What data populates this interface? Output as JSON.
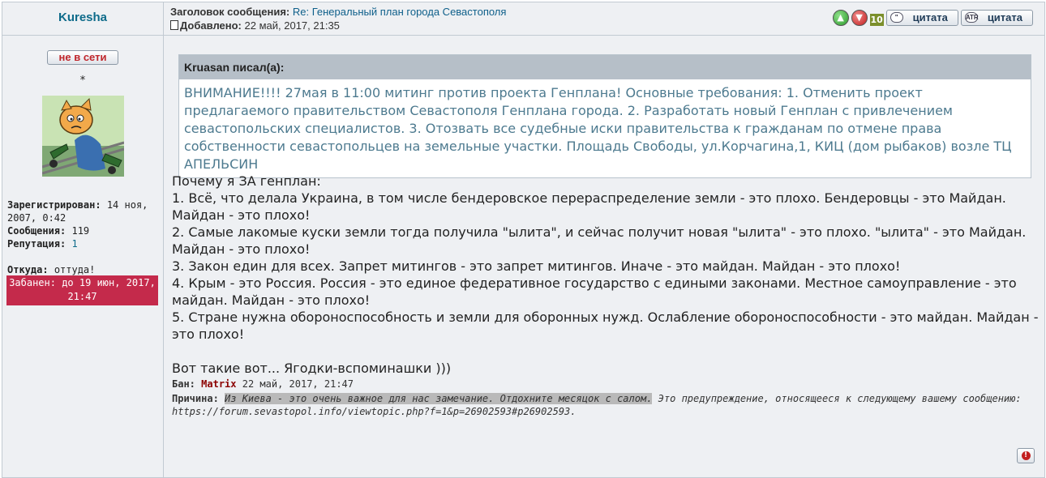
{
  "author": {
    "name": "Kuresha",
    "status_label": "не в сети",
    "rank": "*",
    "registered_label": "Зарегистрирован:",
    "registered_value": "14 ноя, 2007, 0:42",
    "posts_label": "Сообщения:",
    "posts_value": "119",
    "reputation_label": "Репутация:",
    "reputation_value": "1",
    "from_label": "Откуда:",
    "from_value": "оттуда!",
    "banned_text": "Забанен: до 19 июн, 2017, 21:47"
  },
  "header": {
    "subject_label": "Заголовок сообщения:",
    "subject_value": "Re: Генеральный план города Севастополя",
    "date_label": "Добавлено:",
    "date_value": "22 май, 2017, 21:35",
    "rep_count": "10",
    "quote_label_1": "цитата",
    "quote_label_2": "цитата",
    "quote_icon_2_text": "ATR"
  },
  "quote": {
    "header": "Kruasan писал(а):",
    "body": "ВНИМАНИЕ!!!! 27мая в 11:00 митинг против проекта Генплана! Основные требования: 1. Отменить проект предлагаемого правительством Севастополя Генплана города. 2. Разработать новый Генплан с привлечением севастопольских специалистов. 3. Отозвать все судебные иски правительства к гражданам по отмене права собственности севастопольцев на земельные участки. Площадь Свободы, ул.Корчагина,1, КИЦ (дом рыбаков) возле ТЦ АПЕЛЬСИН"
  },
  "post": {
    "lines": [
      "Почему я ЗА генплан:",
      "1. Всё, что делала Украина, в том числе бендеровское перераспределение земли - это плохо. Бендеровцы - это Майдан. Майдан - это плохо!",
      "2. Самые лакомые куски земли тогда получила \"ылита\", и сейчас получит новая \"ылита\" - это плохо. \"ылита\" - это Майдан. Майдан - это плохо!",
      "3. Закон един для всех. Запрет митингов - это запрет митингов. Иначе - это майдан. Майдан - это плохо!",
      "4. Крым - это Россия. Россия - это единое федеративное государство с едиными законами. Местное самоуправление - это майдан. Майдан - это плохо!",
      "5. Стране нужна обороноспособность и земли для оборонных нужд. Ослабление обороноспособности - это майдан. Майдан - это плохо!",
      "",
      "Вот такие вот... Ягодки-вспоминашки )))"
    ]
  },
  "ban": {
    "label": "Бан:",
    "moderator": "Matrix",
    "date": "22 май, 2017, 21:47",
    "reason_label": "Причина:",
    "reason_highlight": "Из Киева - это очень важное для нас замечание. Отдохните месяцок с салом.",
    "reason_rest": "Это предупреждение, относящееся к следующему вашему сообщению: https://forum.sevastopol.info/viewtopic.php?f=1&p=26902593#p26902593."
  },
  "colors": {
    "background": "#eef0f3",
    "border": "#c2cad2",
    "author_name": "#0e6b8a",
    "banned_bg": "#c42a4b",
    "quote_text": "#4d7a8f",
    "moderator": "#8b0000"
  },
  "icons": [
    "rate-up-icon",
    "rate-down-icon",
    "quote-icon",
    "report-icon",
    "post-document-icon"
  ]
}
